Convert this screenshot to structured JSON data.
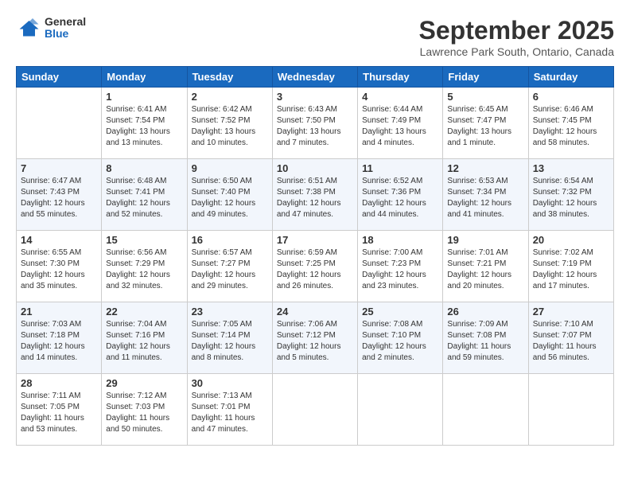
{
  "header": {
    "logo_general": "General",
    "logo_blue": "Blue",
    "month_title": "September 2025",
    "location": "Lawrence Park South, Ontario, Canada"
  },
  "calendar": {
    "days_of_week": [
      "Sunday",
      "Monday",
      "Tuesday",
      "Wednesday",
      "Thursday",
      "Friday",
      "Saturday"
    ],
    "weeks": [
      [
        {
          "day": "",
          "info": ""
        },
        {
          "day": "1",
          "info": "Sunrise: 6:41 AM\nSunset: 7:54 PM\nDaylight: 13 hours\nand 13 minutes."
        },
        {
          "day": "2",
          "info": "Sunrise: 6:42 AM\nSunset: 7:52 PM\nDaylight: 13 hours\nand 10 minutes."
        },
        {
          "day": "3",
          "info": "Sunrise: 6:43 AM\nSunset: 7:50 PM\nDaylight: 13 hours\nand 7 minutes."
        },
        {
          "day": "4",
          "info": "Sunrise: 6:44 AM\nSunset: 7:49 PM\nDaylight: 13 hours\nand 4 minutes."
        },
        {
          "day": "5",
          "info": "Sunrise: 6:45 AM\nSunset: 7:47 PM\nDaylight: 13 hours\nand 1 minute."
        },
        {
          "day": "6",
          "info": "Sunrise: 6:46 AM\nSunset: 7:45 PM\nDaylight: 12 hours\nand 58 minutes."
        }
      ],
      [
        {
          "day": "7",
          "info": "Sunrise: 6:47 AM\nSunset: 7:43 PM\nDaylight: 12 hours\nand 55 minutes."
        },
        {
          "day": "8",
          "info": "Sunrise: 6:48 AM\nSunset: 7:41 PM\nDaylight: 12 hours\nand 52 minutes."
        },
        {
          "day": "9",
          "info": "Sunrise: 6:50 AM\nSunset: 7:40 PM\nDaylight: 12 hours\nand 49 minutes."
        },
        {
          "day": "10",
          "info": "Sunrise: 6:51 AM\nSunset: 7:38 PM\nDaylight: 12 hours\nand 47 minutes."
        },
        {
          "day": "11",
          "info": "Sunrise: 6:52 AM\nSunset: 7:36 PM\nDaylight: 12 hours\nand 44 minutes."
        },
        {
          "day": "12",
          "info": "Sunrise: 6:53 AM\nSunset: 7:34 PM\nDaylight: 12 hours\nand 41 minutes."
        },
        {
          "day": "13",
          "info": "Sunrise: 6:54 AM\nSunset: 7:32 PM\nDaylight: 12 hours\nand 38 minutes."
        }
      ],
      [
        {
          "day": "14",
          "info": "Sunrise: 6:55 AM\nSunset: 7:30 PM\nDaylight: 12 hours\nand 35 minutes."
        },
        {
          "day": "15",
          "info": "Sunrise: 6:56 AM\nSunset: 7:29 PM\nDaylight: 12 hours\nand 32 minutes."
        },
        {
          "day": "16",
          "info": "Sunrise: 6:57 AM\nSunset: 7:27 PM\nDaylight: 12 hours\nand 29 minutes."
        },
        {
          "day": "17",
          "info": "Sunrise: 6:59 AM\nSunset: 7:25 PM\nDaylight: 12 hours\nand 26 minutes."
        },
        {
          "day": "18",
          "info": "Sunrise: 7:00 AM\nSunset: 7:23 PM\nDaylight: 12 hours\nand 23 minutes."
        },
        {
          "day": "19",
          "info": "Sunrise: 7:01 AM\nSunset: 7:21 PM\nDaylight: 12 hours\nand 20 minutes."
        },
        {
          "day": "20",
          "info": "Sunrise: 7:02 AM\nSunset: 7:19 PM\nDaylight: 12 hours\nand 17 minutes."
        }
      ],
      [
        {
          "day": "21",
          "info": "Sunrise: 7:03 AM\nSunset: 7:18 PM\nDaylight: 12 hours\nand 14 minutes."
        },
        {
          "day": "22",
          "info": "Sunrise: 7:04 AM\nSunset: 7:16 PM\nDaylight: 12 hours\nand 11 minutes."
        },
        {
          "day": "23",
          "info": "Sunrise: 7:05 AM\nSunset: 7:14 PM\nDaylight: 12 hours\nand 8 minutes."
        },
        {
          "day": "24",
          "info": "Sunrise: 7:06 AM\nSunset: 7:12 PM\nDaylight: 12 hours\nand 5 minutes."
        },
        {
          "day": "25",
          "info": "Sunrise: 7:08 AM\nSunset: 7:10 PM\nDaylight: 12 hours\nand 2 minutes."
        },
        {
          "day": "26",
          "info": "Sunrise: 7:09 AM\nSunset: 7:08 PM\nDaylight: 11 hours\nand 59 minutes."
        },
        {
          "day": "27",
          "info": "Sunrise: 7:10 AM\nSunset: 7:07 PM\nDaylight: 11 hours\nand 56 minutes."
        }
      ],
      [
        {
          "day": "28",
          "info": "Sunrise: 7:11 AM\nSunset: 7:05 PM\nDaylight: 11 hours\nand 53 minutes."
        },
        {
          "day": "29",
          "info": "Sunrise: 7:12 AM\nSunset: 7:03 PM\nDaylight: 11 hours\nand 50 minutes."
        },
        {
          "day": "30",
          "info": "Sunrise: 7:13 AM\nSunset: 7:01 PM\nDaylight: 11 hours\nand 47 minutes."
        },
        {
          "day": "",
          "info": ""
        },
        {
          "day": "",
          "info": ""
        },
        {
          "day": "",
          "info": ""
        },
        {
          "day": "",
          "info": ""
        }
      ]
    ]
  }
}
